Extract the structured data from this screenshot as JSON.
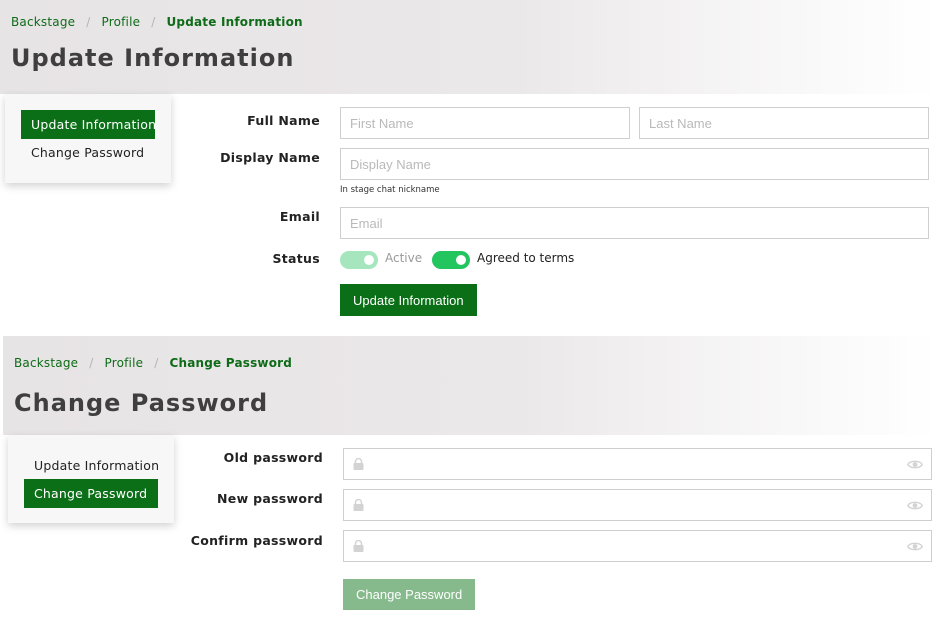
{
  "update_section": {
    "breadcrumb": [
      "Backstage",
      "Profile"
    ],
    "breadcrumb_active": "Update Information",
    "title": "Update Information",
    "sidebar": {
      "items": [
        {
          "label": "Update Information",
          "active": true
        },
        {
          "label": "Change Password",
          "active": false
        }
      ]
    },
    "form": {
      "full_name_label": "Full Name",
      "first_name_placeholder": "First Name",
      "last_name_placeholder": "Last Name",
      "display_name_label": "Display Name",
      "display_name_placeholder": "Display Name",
      "display_name_help": "In stage chat nickname",
      "email_label": "Email",
      "email_placeholder": "Email",
      "status_label": "Status",
      "toggles": [
        {
          "label": "Active",
          "on": false
        },
        {
          "label": "Agreed to terms",
          "on": true
        }
      ],
      "submit_label": "Update Information"
    }
  },
  "password_section": {
    "breadcrumb": [
      "Backstage",
      "Profile"
    ],
    "breadcrumb_active": "Change Password",
    "title": "Change Password",
    "sidebar": {
      "items": [
        {
          "label": "Update Information",
          "active": false
        },
        {
          "label": "Change Password",
          "active": true
        }
      ]
    },
    "form": {
      "old_password_label": "Old password",
      "new_password_label": "New password",
      "confirm_password_label": "Confirm password",
      "submit_label": "Change Password",
      "submit_disabled": true
    }
  },
  "icons": {
    "lock": "lock-icon",
    "eye": "eye-icon"
  },
  "colors": {
    "brand_green": "#0b6f17",
    "toggle_on": "#22c55e",
    "toggle_off": "#a5e6bf",
    "disabled_button": "#86b98b",
    "hero_background": "#e7e4e5"
  }
}
